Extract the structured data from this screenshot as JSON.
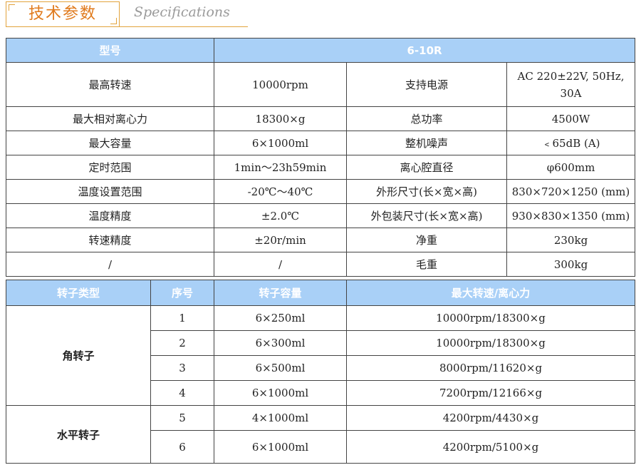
{
  "header": {
    "title": "技术参数",
    "subtitle": "Specifications"
  },
  "specs": {
    "model_label": "型号",
    "model_value": "6-10R",
    "rows": [
      {
        "l1": "最高转速",
        "v1": "10000rpm",
        "l2": "支持电源",
        "v2": "AC 220±22V, 50Hz, 30A"
      },
      {
        "l1": "最大相对离心力",
        "v1": "18300×g",
        "l2": "总功率",
        "v2": "4500W"
      },
      {
        "l1": "最大容量",
        "v1": "6×1000ml",
        "l2": "整机噪声",
        "v2": "﹤65dB (A)"
      },
      {
        "l1": "定时范围",
        "v1": "1min～23h59min",
        "l2": "离心腔直径",
        "v2": "φ600mm"
      },
      {
        "l1": "温度设置范围",
        "v1": "-20℃～40℃",
        "l2": "外形尺寸(长×宽×高)",
        "v2": "830×720×1250 (mm)"
      },
      {
        "l1": "温度精度",
        "v1": "±2.0℃",
        "l2": "外包装尺寸(长×宽×高)",
        "v2": "930×830×1350 (mm)"
      },
      {
        "l1": "转速精度",
        "v1": "±20r/min",
        "l2": "净重",
        "v2": "230kg"
      },
      {
        "l1": "/",
        "v1": "/",
        "l2": "毛重",
        "v2": "300kg"
      }
    ]
  },
  "rotors": {
    "headers": [
      "转子类型",
      "序号",
      "转子容量",
      "最大转速/离心力"
    ],
    "groups": [
      {
        "type": "角转子",
        "rows": [
          {
            "no": "1",
            "cap": "6×250ml",
            "max": "10000rpm/18300×g"
          },
          {
            "no": "2",
            "cap": "6×300ml",
            "max": "10000rpm/18300×g"
          },
          {
            "no": "3",
            "cap": "6×500ml",
            "max": "8000rpm/11620×g"
          },
          {
            "no": "4",
            "cap": "6×1000ml",
            "max": "7200rpm/12166×g"
          }
        ]
      },
      {
        "type": "水平转子",
        "rows": [
          {
            "no": "5",
            "cap": "4×1000ml",
            "max": "4200rpm/4430×g"
          },
          {
            "no": "6",
            "cap": "6×1000ml",
            "max": "4200rpm/5100×g"
          }
        ]
      }
    ]
  },
  "colors": {
    "header_bg": "#a9d0f7",
    "accent": "#e07a1c"
  }
}
